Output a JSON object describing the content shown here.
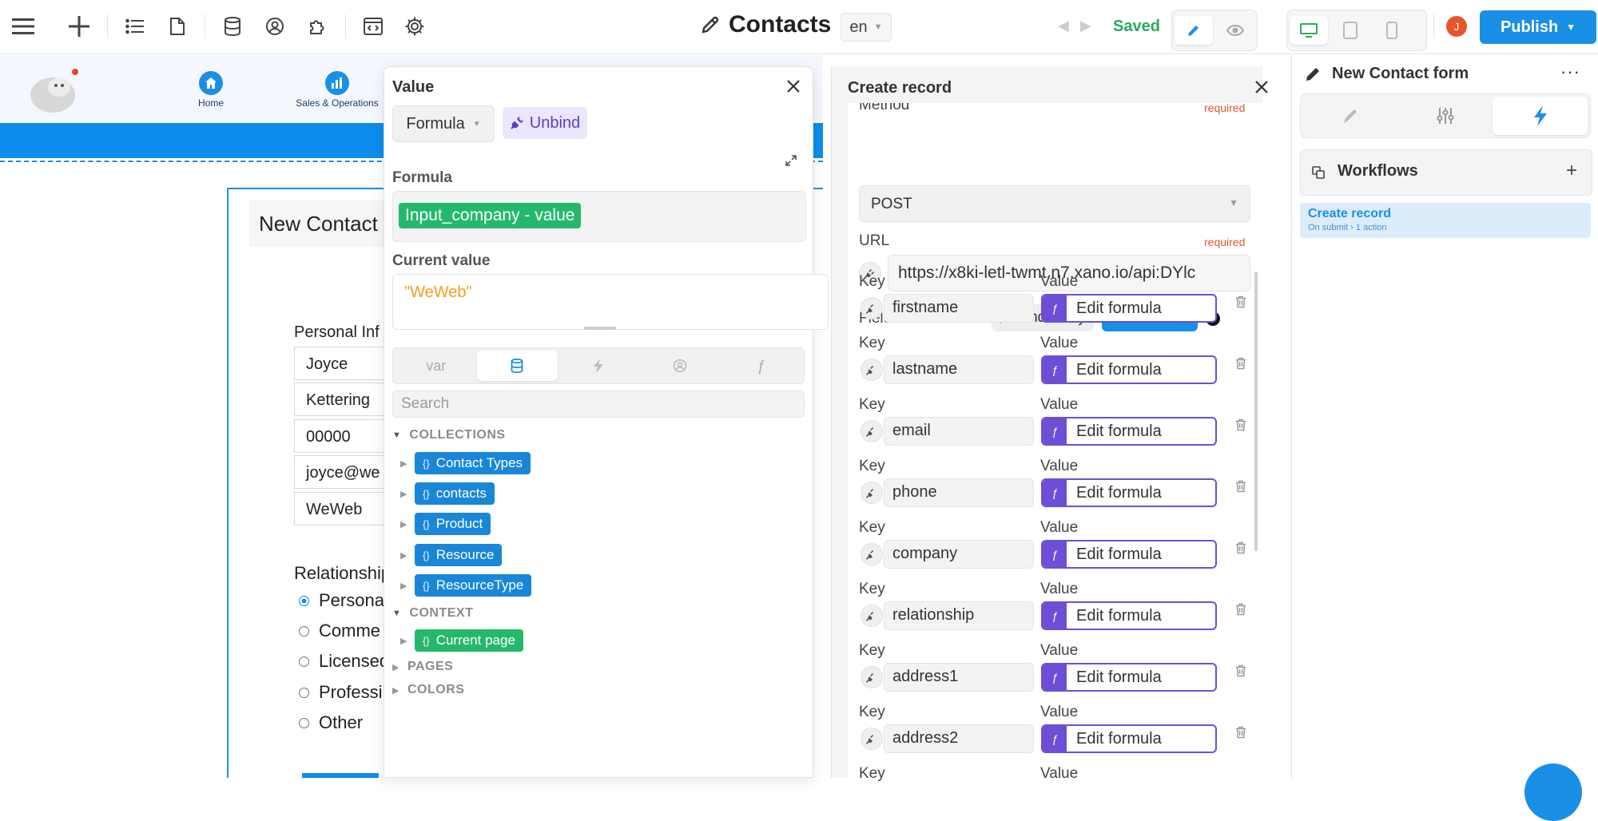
{
  "topbar": {
    "page_title": "Contacts",
    "language": "en",
    "status": "Saved",
    "publish_label": "Publish",
    "avatar_initial": "J"
  },
  "site": {
    "nav": [
      {
        "label": "Home",
        "icon": "home-icon"
      },
      {
        "label": "Sales & Operations",
        "icon": "bar-chart-icon"
      }
    ],
    "form_title": "New Contact",
    "personal_label": "Personal Inf",
    "fields": [
      "Joyce",
      "Kettering",
      "00000",
      "joyce@we",
      "WeWeb"
    ],
    "relationship_label": "Relationship",
    "radios": [
      {
        "label": "Personal",
        "checked": true
      },
      {
        "label": "Comme",
        "checked": false
      },
      {
        "label": "Licensed",
        "checked": false
      },
      {
        "label": "Professi",
        "checked": false
      },
      {
        "label": "Other",
        "checked": false
      }
    ]
  },
  "value_panel": {
    "title": "Value",
    "mode": "Formula",
    "unbind_label": "Unbind",
    "formula_label": "Formula",
    "formula_chip": "Input_company - value",
    "current_value_label": "Current value",
    "current_value": "\"WeWeb\"",
    "tabs": [
      {
        "label": "var",
        "icon": "variable-icon"
      },
      {
        "label": "",
        "icon": "database-icon"
      },
      {
        "label": "",
        "icon": "lightning-icon"
      },
      {
        "label": "",
        "icon": "user-circle-icon"
      },
      {
        "label": "ƒ",
        "icon": "function-icon"
      }
    ],
    "search_placeholder": "Search",
    "sections": {
      "collections": "COLLECTIONS",
      "context": "CONTEXT",
      "pages": "PAGES",
      "colors": "COLORS"
    },
    "collections": [
      "Contact Types",
      "contacts",
      "Product",
      "Resource",
      "ResourceType"
    ],
    "context_items": [
      "Current page"
    ]
  },
  "record_panel": {
    "title": "Create record",
    "method_label": "Method",
    "method_value": "POST",
    "required_label": "required",
    "url_label": "URL",
    "url_value": "https://x8ki-letl-twmt.n7.xano.io/api:DYlc",
    "fields_label": "Fields",
    "bind_array_label": "Bind Array",
    "add_item_label": "+ Add item",
    "key_label": "Key",
    "value_label": "Value",
    "edit_formula_label": "Edit formula",
    "keys": [
      "firstname",
      "lastname",
      "email",
      "phone",
      "company",
      "relationship",
      "address1",
      "address2"
    ]
  },
  "right_panel": {
    "title": "New Contact form",
    "workflows_label": "Workflows",
    "workflow_item": {
      "title": "Create record",
      "subtitle": "On submit › 1 action"
    }
  },
  "colors": {
    "accent": "#1a8fe6",
    "success": "#25b86b",
    "formula_purple": "#6d4fd6",
    "required": "#e8542c"
  }
}
